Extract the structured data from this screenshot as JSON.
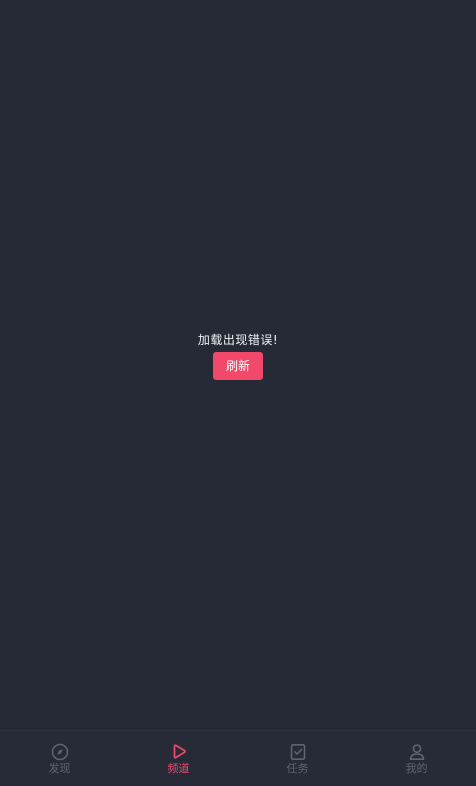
{
  "error": {
    "message": "加载出现错误!",
    "refresh_label": "刷新"
  },
  "tabbar": {
    "items": [
      {
        "label": "发现",
        "icon": "compass-icon",
        "active": false
      },
      {
        "label": "频道",
        "icon": "play-icon",
        "active": true
      },
      {
        "label": "任务",
        "icon": "task-check-icon",
        "active": false
      },
      {
        "label": "我的",
        "icon": "user-icon",
        "active": false
      }
    ]
  },
  "colors": {
    "background": "#262a37",
    "accent": "#f2486a",
    "inactive": "#5f6372",
    "text": "#f1f2f5"
  }
}
